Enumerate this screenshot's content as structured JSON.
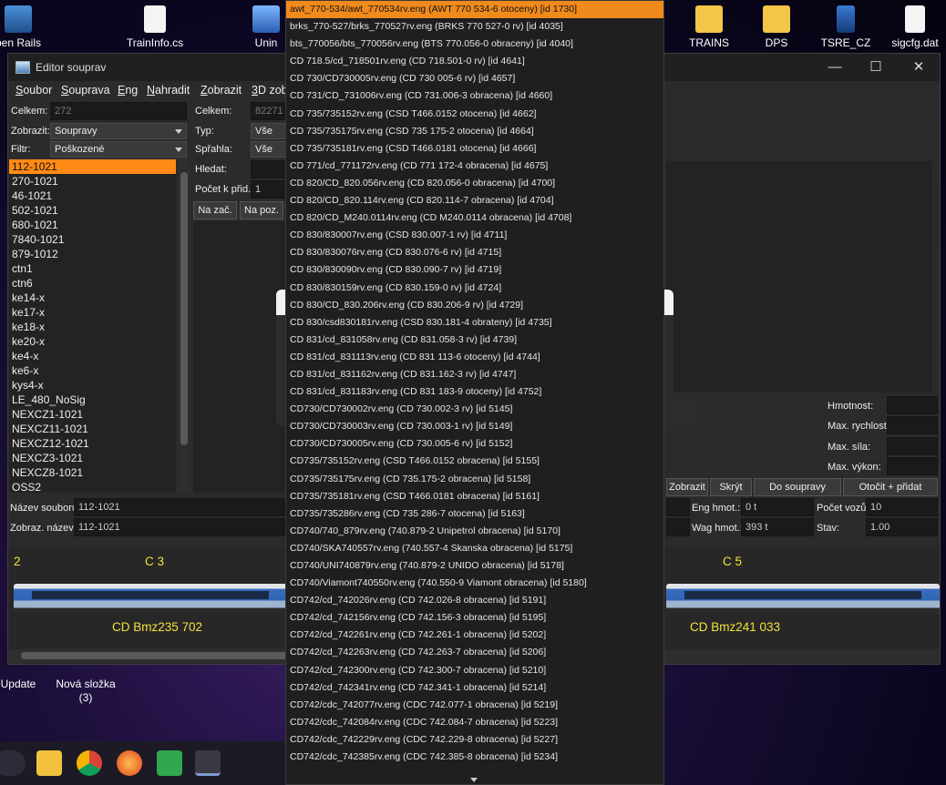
{
  "desktop_icons": [
    {
      "label": "pen Rails",
      "icon": "open-rails-icon"
    },
    {
      "label": "TrainInfo.cs",
      "icon": "cs-file-icon"
    },
    {
      "label": "Unin",
      "icon": "uninstall-icon"
    },
    {
      "label": "TRAINS",
      "icon": "folder-icon"
    },
    {
      "label": "DPS",
      "icon": "folder-icon"
    },
    {
      "label": "TSRE_CZ",
      "icon": "tsre-icon"
    },
    {
      "label": "sigcfg.dat",
      "icon": "file-icon"
    },
    {
      "label": "Update",
      "icon": "update-icon"
    },
    {
      "label": "Nová složka",
      "sub": "(3)",
      "icon": "folder-icon"
    }
  ],
  "window": {
    "title": "Editor souprav",
    "controls": [
      "—",
      "☐",
      "✕"
    ]
  },
  "menu": [
    "Soubor",
    "Souprava",
    "Eng",
    "Nahradit",
    "Zobrazit",
    "3D zob"
  ],
  "left_panel": {
    "celkem_label": "Celkem:",
    "celkem_value": "272",
    "zobrazit_label": "Zobrazit:",
    "zobrazit_value": "Soupravy",
    "filtr_label": "Filtr:",
    "filtr_value": "Poškozené",
    "consists": [
      "112-1021",
      "270-1021",
      "46-1021",
      "502-1021",
      "680-1021",
      "7840-1021",
      "879-1012",
      "ctn1",
      "ctn6",
      "ke14-x",
      "ke17-x",
      "ke18-x",
      "ke20-x",
      "ke4-x",
      "ke6-x",
      "kys4-x",
      "LE_480_NoSig",
      "NEXCZ1-1021",
      "NEXCZ11-1021",
      "NEXCZ12-1021",
      "NEXCZ3-1021",
      "NEXCZ8-1021",
      "OSS2"
    ],
    "selected": "112-1021"
  },
  "mid_panel": {
    "celkem_label": "Celkem:",
    "celkem_value": "82271 /",
    "typ_label": "Typ:",
    "typ_value": "Vše",
    "sprahla_label": "Spřahla:",
    "sprahla_value": "Vše",
    "hledat_label": "Hledat:",
    "pocet_label": "Počet k přid.:",
    "pocet_value": "1",
    "btn_nazac": "Na zač.",
    "btn_napoz": "Na poz."
  },
  "right_panel": {
    "hmotnost_label": "Hmotnost:",
    "max_rychlost_label": "Max. rychlost:",
    "max_sila_label": "Max. síla:",
    "max_vykon_label": "Max. výkon:",
    "btn_zobrazit": "Zobrazit",
    "btn_skryt": "Skrýt",
    "btn_do_soupravy": "Do soupravy",
    "btn_otocit": "Otočit + přidat"
  },
  "bottom_fields": {
    "nazev_souboru_label": "Název souboru:",
    "nazev_souboru_value": "112-1021",
    "zobraz_nazev_label": "Zobraz. název:",
    "zobraz_nazev_value": "112-1021",
    "eng_hmot_label": "Eng hmot.:",
    "eng_hmot_value": "0 t",
    "wag_hmot_label": "Wag hmot.:",
    "wag_hmot_value": "393 t",
    "pocet_vozu_label": "Počet vozů:",
    "pocet_vozu_value": "10",
    "stav_label": "Stav:",
    "stav_value": "1.00"
  },
  "train_view": {
    "index_left": "2",
    "coach_left_num": "C 3",
    "coach_right_num": "C 5",
    "coach_left_name": "CD Bmz235 702",
    "coach_right_name": "CD Bmz241 033"
  },
  "dropdown_items": [
    "awt_770-534/awt_770534rv.eng  (AWT 770 534-6 otoceny)  [id 1730]",
    "brks_770-527/brks_770527rv.eng  (BRKS 770 527-0 rv)  [id 4035]",
    "bts_770056/bts_770056rv.eng  (BTS 770.056-0 obraceny)  [id 4040]",
    "CD 718.5/cd_718501rv.eng  (CD 718.501-0 rv)  [id 4641]",
    "CD 730/CD730005rv.eng  (CD 730 005-6 rv)  [id 4657]",
    "CD 731/CD_731006rv.eng  (CD 731.006-3 obracena)  [id 4660]",
    "CD 735/735152rv.eng  (CSD T466.0152 otocena)  [id 4662]",
    "CD 735/735175rv.eng  (CSD 735 175-2 otocena)  [id 4664]",
    "CD 735/735181rv.eng  (CSD T466.0181 otocena)  [id 4666]",
    "CD 771/cd_771172rv.eng  (CD 771 172-4 obracena)  [id 4675]",
    "CD 820/CD_820.056rv.eng  (CD 820.056-0 obracena)  [id 4700]",
    "CD 820/CD_820.114rv.eng  (CD 820.114-7 obracena)  [id 4704]",
    "CD 820/CD_M240.0114rv.eng  (CD M240.0114 obracena)  [id 4708]",
    "CD 830/830007rv.eng  (CSD 830.007-1 rv)  [id 4711]",
    "CD 830/830076rv.eng  (CD 830.076-6 rv)  [id 4715]",
    "CD 830/830090rv.eng  (CD 830.090-7 rv)  [id 4719]",
    "CD 830/830159rv.eng  (CD 830.159-0 rv)  [id 4724]",
    "CD 830/CD_830.206rv.eng  (CD 830.206-9 rv)  [id 4729]",
    "CD 830/csd830181rv.eng  (CSD 830.181-4 obrateny)  [id 4735]",
    "CD 831/cd_831058rv.eng  (CD 831.058-3 rv)  [id 4739]",
    "CD 831/cd_831113rv.eng  (CD 831 113-6 otoceny)  [id 4744]",
    "CD 831/cd_831162rv.eng  (CD 831.162-3 rv)  [id 4747]",
    "CD 831/cd_831183rv.eng  (CD 831 183-9 otoceny)  [id 4752]",
    "CD730/CD730002rv.eng  (CD 730.002-3 rv)  [id 5145]",
    "CD730/CD730003rv.eng  (CD 730.003-1 rv)  [id 5149]",
    "CD730/CD730005rv.eng  (CD 730.005-6 rv)  [id 5152]",
    "CD735/735152rv.eng  (CSD T466.0152 obracena)  [id 5155]",
    "CD735/735175rv.eng  (CD 735.175-2 obracena)  [id 5158]",
    "CD735/735181rv.eng  (CSD T466.0181 obracena)  [id 5161]",
    "CD735/735286rv.eng  (CD 735 286-7 otocena)  [id 5163]",
    "CD740/740_879rv.eng  (740.879-2 Unipetrol obracena)  [id 5170]",
    "CD740/SKA740557rv.eng  (740.557-4 Skanska obracena)  [id 5175]",
    "CD740/UNI740879rv.eng  (740.879-2 UNIDO obracena)  [id 5178]",
    "CD740/Viamont740550rv.eng  (740.550-9 Viamont obracena)  [id 5180]",
    "CD742/cd_742026rv.eng  (CD 742.026-8 obracena)  [id 5191]",
    "CD742/cd_742156rv.eng  (CD 742.156-3 obracena)  [id 5195]",
    "CD742/cd_742261rv.eng  (CD 742.261-1 obracena)  [id 5202]",
    "CD742/cd_742263rv.eng  (CD 742.263-7 obracena)  [id 5206]",
    "CD742/cd_742300rv.eng  (CD 742.300-7 obracena)  [id 5210]",
    "CD742/cd_742341rv.eng  (CD 742.341-1 obracena)  [id 5214]",
    "CD742/cdc_742077rv.eng  (CDC 742.077-1 obracena)  [id 5219]",
    "CD742/cdc_742084rv.eng  (CDC 742.084-7 obracena)  [id 5223]",
    "CD742/cdc_742229rv.eng  (CDC 742.229-8 obracena)  [id 5227]",
    "CD742/cdc_742385rv.eng  (CDC 742.385-8 obracena)  [id 5234]"
  ],
  "dropdown_selected_index": 0,
  "colors": {
    "selection": "#f08a1c",
    "label_yellow": "#f2e23a",
    "window_bg": "#2b2b2b"
  }
}
